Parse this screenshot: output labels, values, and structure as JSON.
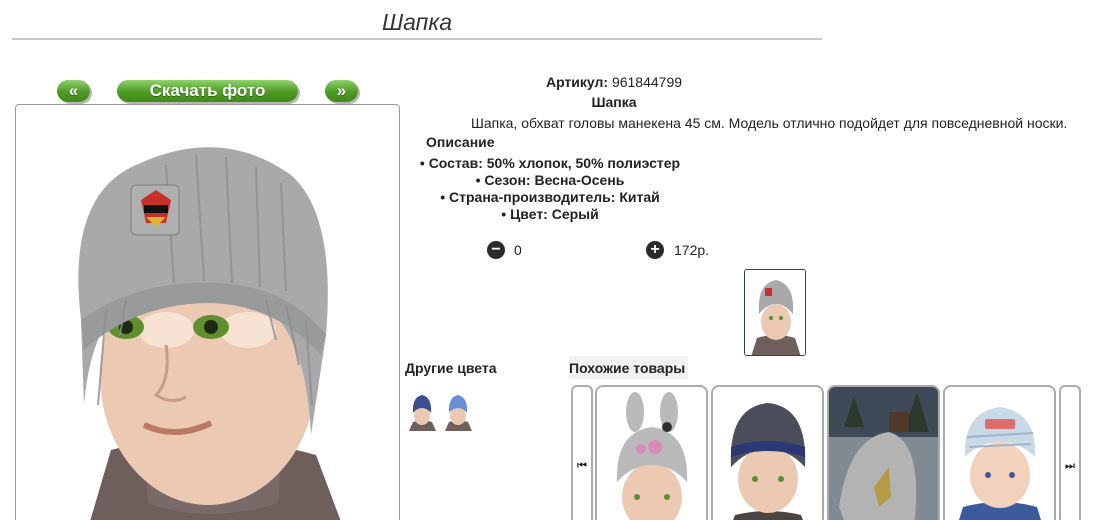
{
  "page": {
    "title": "Шапка"
  },
  "gallery": {
    "prev_label": "«",
    "download_label": "Скачать фото",
    "next_label": "»"
  },
  "product": {
    "sku_label": "Артикул:",
    "sku_value": "961844799",
    "name": "Шапка",
    "description": "Шапка, обхват головы манекена 45 см. Модель отлично подойдет для повседневной носки.",
    "description_heading": "Описание",
    "attributes": [
      "Состав: 50% хлопок, 50% полиэстер",
      "Сезон: Весна-Осень",
      "Страна-производитель: Китай",
      "Цвет: Серый"
    ],
    "quantity": "0",
    "price": "172р.",
    "minus_icon": "−",
    "plus_icon": "+"
  },
  "other_colors": {
    "label": "Другие цвета"
  },
  "similar": {
    "label": "Похожие товары",
    "prev_icon": "⏮",
    "next_icon": "⏭"
  },
  "colors": {
    "hat_gray": "#a9a9ab",
    "button_green": "#4d9a24",
    "thumb_border": "#2c3f73"
  }
}
